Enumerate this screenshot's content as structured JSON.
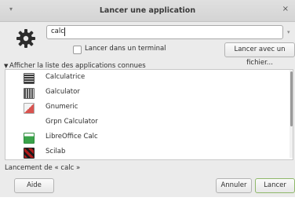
{
  "window": {
    "title": "Lancer une application",
    "menu_glyph": "▾",
    "close_glyph": "×"
  },
  "search": {
    "value": "calc",
    "dropdown_glyph": "▾"
  },
  "options": {
    "terminal_label": "Lancer dans un terminal",
    "file_button": "Lancer avec un fichier..."
  },
  "expander": {
    "arrow": "▼",
    "label": "Afficher la liste des applications connues"
  },
  "apps": [
    {
      "name": "Calculatrice",
      "icon": "calculator-icon"
    },
    {
      "name": "Galculator",
      "icon": "galculator-icon"
    },
    {
      "name": "Gnumeric",
      "icon": "gnumeric-icon"
    },
    {
      "name": "Grpn Calculator",
      "icon": ""
    },
    {
      "name": "LibreOffice Calc",
      "icon": "libreoffice-calc-icon"
    },
    {
      "name": "Scilab",
      "icon": "scilab-icon"
    }
  ],
  "status": "Lancement de « calc »",
  "buttons": {
    "help": "Aide",
    "cancel": "Annuler",
    "launch": "Lancer"
  }
}
